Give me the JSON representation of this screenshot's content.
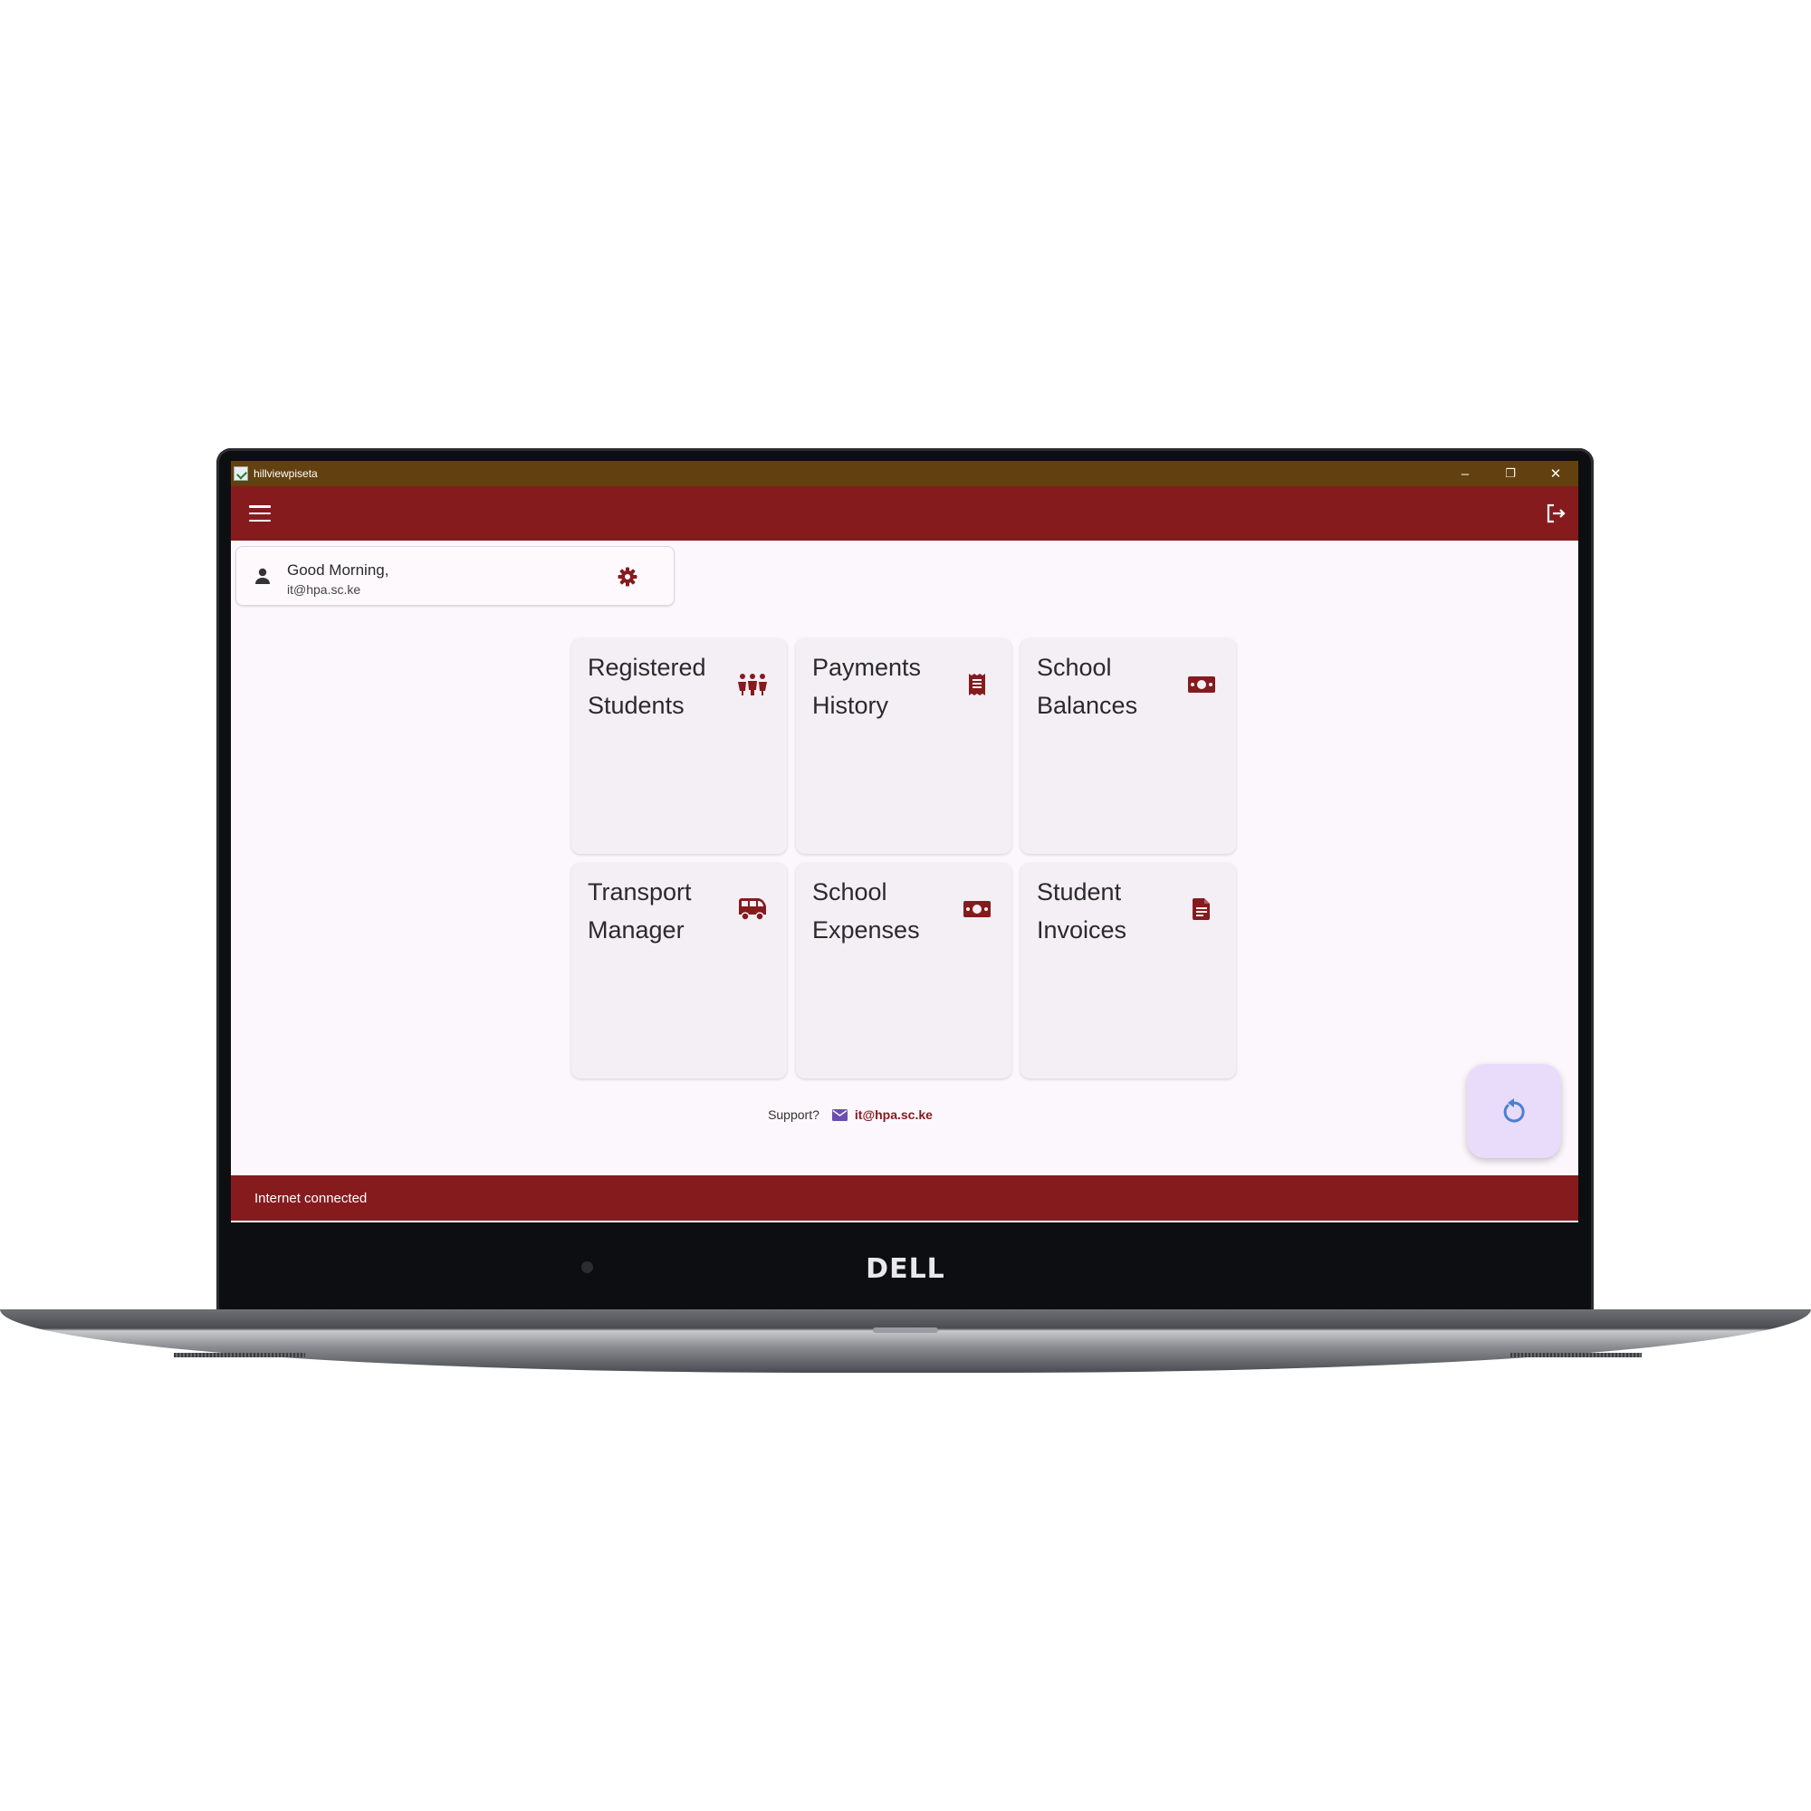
{
  "device": {
    "brand": "DELL"
  },
  "window": {
    "title": "hillviewpiseta",
    "controls": {
      "minimize": "–",
      "maximize": "❐",
      "close": "✕"
    }
  },
  "colors": {
    "primary": "#861b1e",
    "titlebar": "#62400f",
    "background": "#fcf7fc",
    "tile": "#f4eff5",
    "fab": "#e9dcfb",
    "fab_icon": "#4a7fd6",
    "mail_icon": "#6a4fb0"
  },
  "appbar": {
    "menu_icon": "hamburger-menu-icon",
    "logout_icon": "logout-icon"
  },
  "greeting": {
    "line1": "Good Morning,",
    "line2": "it@hpa.sc.ke",
    "person_icon": "person-icon",
    "settings_icon": "gear-icon"
  },
  "tiles": [
    {
      "label": "Registered\nStudents",
      "icon": "group-icon"
    },
    {
      "label": "Payments\nHistory",
      "icon": "receipt-icon"
    },
    {
      "label": "School\nBalances",
      "icon": "money-bill-icon"
    },
    {
      "label": "Transport\nManager",
      "icon": "bus-icon"
    },
    {
      "label": "School\nExpenses",
      "icon": "money-bill-icon"
    },
    {
      "label": "Student\nInvoices",
      "icon": "invoice-icon"
    }
  ],
  "support": {
    "label": "Support?",
    "email": "it@hpa.sc.ke",
    "icon": "mail-icon"
  },
  "fab": {
    "icon": "refresh-icon"
  },
  "status": {
    "text": "Internet connected"
  }
}
